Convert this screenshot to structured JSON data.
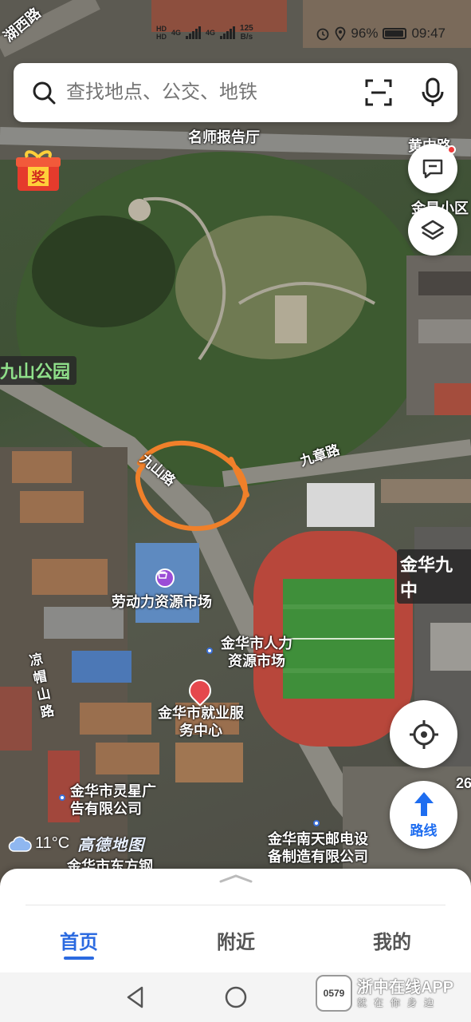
{
  "status_bar": {
    "sim1": "HD",
    "sim2": "HD",
    "network": "4G",
    "speed_value": "125",
    "speed_unit": "B/s",
    "battery_percent": "96%",
    "battery_level": 0.96,
    "time": "09:47"
  },
  "search": {
    "placeholder": "查找地点、公交、地铁"
  },
  "map": {
    "labels": {
      "road_top_left": "湖西路",
      "auditorium": "名师报告厅",
      "road_top_right": "黄中路",
      "community": "金星小区",
      "park": "九山公园",
      "road_jiushan": "九山路",
      "road_jiuzhang": "九章路",
      "school": "金华九中",
      "labor_market": "劳动力资源市场",
      "hr_market": "金华市人力资源市场",
      "employment_center": "金华市就业服务中心",
      "road_liangmao": "凉帽山路",
      "ad_company": "金华市灵星广告有限公司",
      "telecom_company": "金华南天邮电设备制造有限公司",
      "cut_label": "金华市东方钢",
      "edge_number": "26"
    },
    "colors": {
      "track": "#b8473b",
      "field": "#3f8f3a",
      "highlight_circle": "#f0802a",
      "poi_purple": "#9b4dd6",
      "poi_red": "#e5484d"
    }
  },
  "weather": {
    "temperature": "11°C",
    "brand": "高德地图",
    "icon": "cloud-icon"
  },
  "floating_buttons": {
    "route_label": "路线"
  },
  "tabs": [
    {
      "label": "首页",
      "active": true
    },
    {
      "label": "附近",
      "active": false
    },
    {
      "label": "我的",
      "active": false
    }
  ],
  "watermark": {
    "title": "浙中在线APP",
    "subtitle": "就在你身边",
    "logo_text": "0579"
  }
}
